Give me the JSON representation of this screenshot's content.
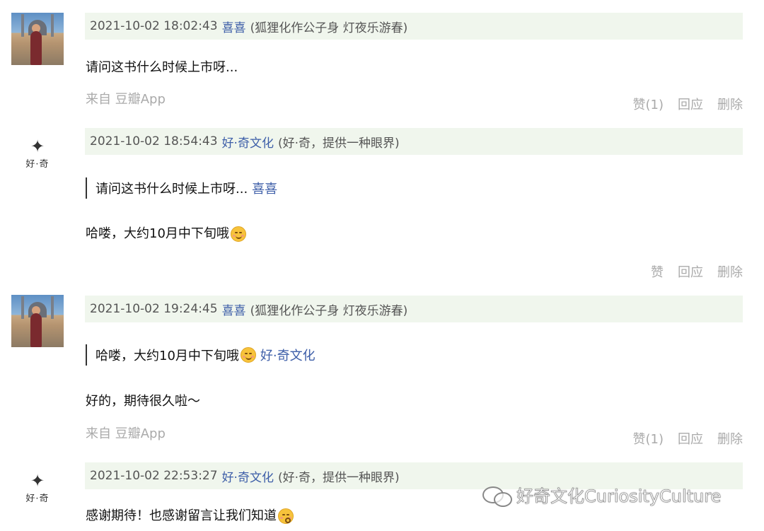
{
  "comments": [
    {
      "timestamp": "2021-10-02 18:02:43",
      "user": "喜喜",
      "signature": "(狐狸化作公子身 灯夜乐游春)",
      "text": "请问这书什么时候上市呀...",
      "source": "来自 豆瓣App",
      "actions": {
        "like": "赞(1)",
        "reply": "回应",
        "delete": "删除"
      }
    },
    {
      "timestamp": "2021-10-02 18:54:43",
      "user": "好·奇文化",
      "signature": "(好·奇，提供一种眼界)",
      "avatar_text": "好·奇",
      "quote_text": "请问这书什么时候上市呀...",
      "quote_author": "喜喜",
      "text": "哈喽，大约10月中下旬哦",
      "actions": {
        "like": "赞",
        "reply": "回应",
        "delete": "删除"
      }
    },
    {
      "timestamp": "2021-10-02 19:24:45",
      "user": "喜喜",
      "signature": "(狐狸化作公子身 灯夜乐游春)",
      "quote_text": "哈喽，大约10月中下旬哦",
      "quote_author": "好·奇文化",
      "text": "好的，期待很久啦～",
      "source": "来自 豆瓣App",
      "actions": {
        "like": "赞(1)",
        "reply": "回应",
        "delete": "删除"
      }
    },
    {
      "timestamp": "2021-10-02 22:53:27",
      "user": "好·奇文化",
      "signature": "(好·奇，提供一种眼界)",
      "avatar_text": "好·奇",
      "text": "感谢期待！也感谢留言让我们知道"
    }
  ],
  "watermark": "好奇文化CuriosityCulture",
  "colors": {
    "header_bg": "#f0f6ed",
    "link": "#3d5ea8",
    "muted": "#aaaaaa"
  }
}
